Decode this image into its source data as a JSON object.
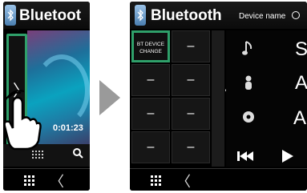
{
  "left_screen": {
    "title": "Bluetoot",
    "time": "0:01:23",
    "side_tab_label": "〉"
  },
  "right_screen": {
    "title": "Bluetooth",
    "device_name_label": "Device name",
    "keypad": {
      "bt_device_change_line1": "BT DEVICE",
      "bt_device_change_line2": "CHANGE",
      "dash": "–"
    },
    "collapse_chevron": "〈",
    "media_letters": [
      "S",
      "A",
      "Al"
    ]
  },
  "bottom_bar": {
    "back_chevron": "〈"
  },
  "colors": {
    "highlight": "#2fa06a",
    "background": "#000000"
  }
}
